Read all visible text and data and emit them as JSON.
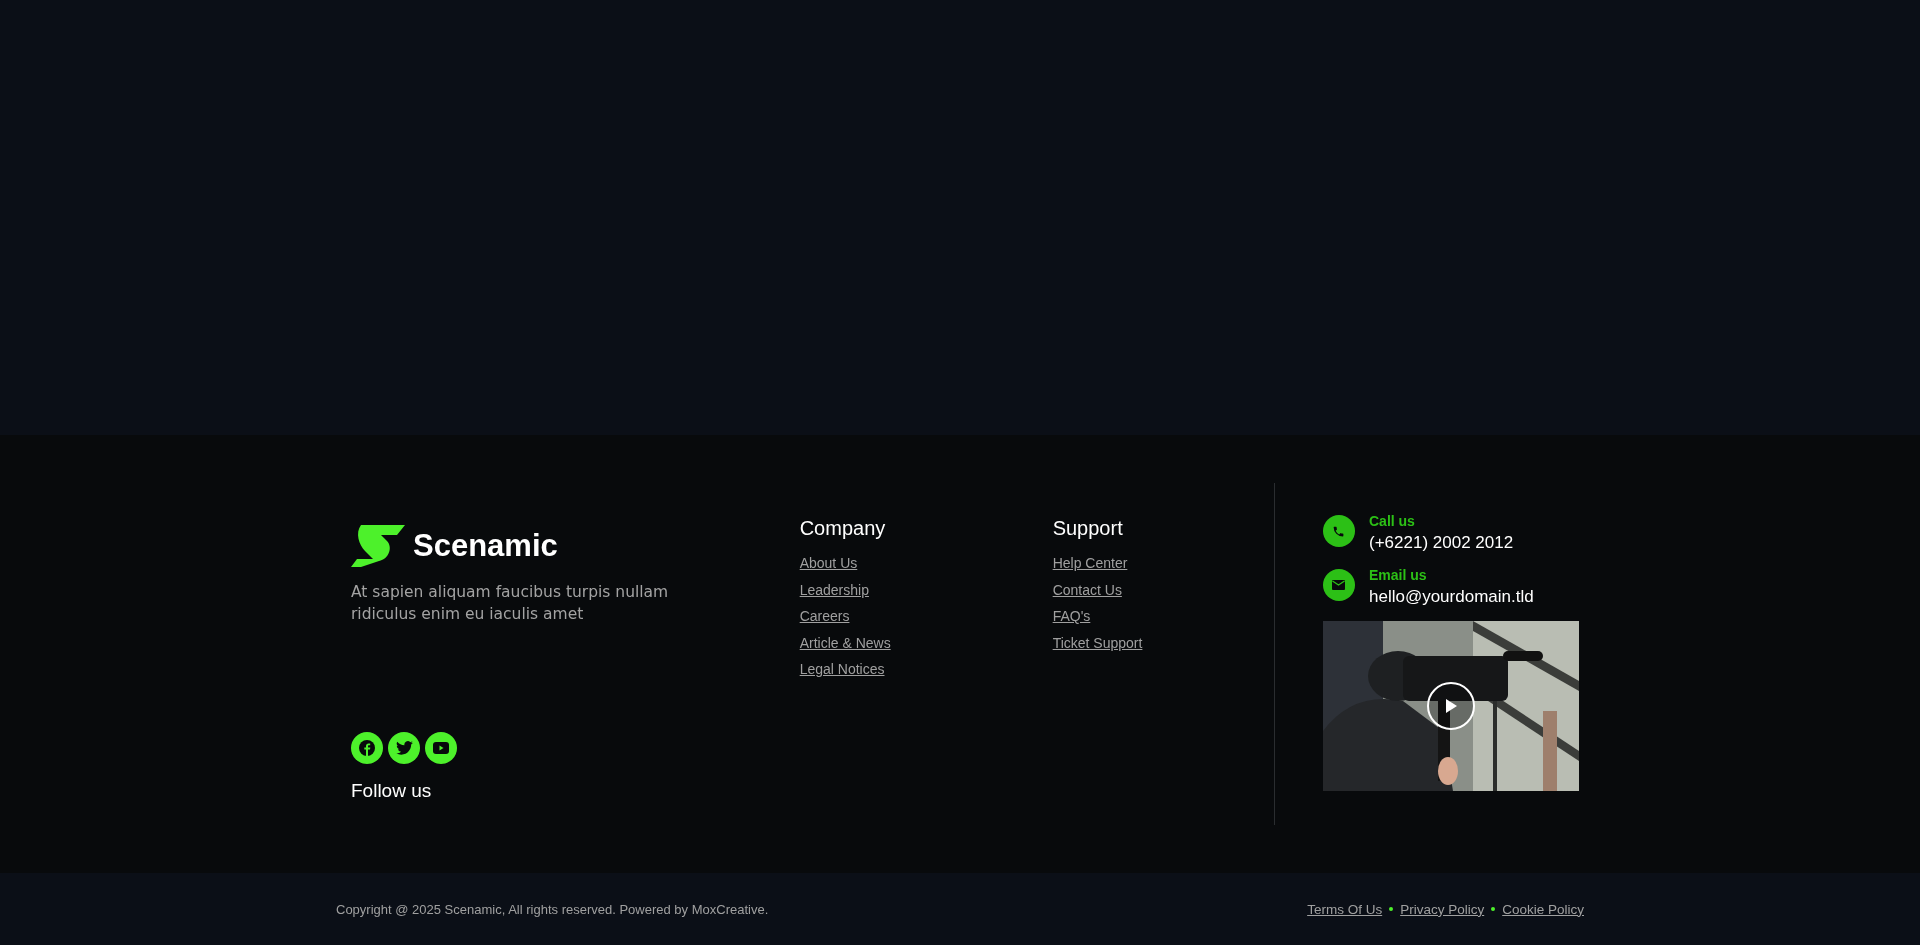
{
  "brand": {
    "name": "Scenamic",
    "description": "At sapien aliquam faucibus turpis nullam ridiculus enim eu iaculis amet"
  },
  "social": {
    "icons": [
      {
        "kind": "facebook"
      },
      {
        "kind": "twitter"
      },
      {
        "kind": "youtube"
      }
    ],
    "label": "Follow us"
  },
  "columns": [
    {
      "title": "Company",
      "links": [
        "About Us",
        "Leadership",
        "Careers",
        "Article & News",
        "Legal Notices"
      ]
    },
    {
      "title": "Support",
      "links": [
        "Help Center",
        "Contact Us",
        "FAQ's",
        "Ticket Support"
      ]
    }
  ],
  "contacts": [
    {
      "kind": "phone",
      "label": "Call us",
      "value": "(+6221) 2002 2012"
    },
    {
      "kind": "email",
      "label": "Email us",
      "value": "hello@yourdomain.tld"
    }
  ],
  "bottom_bar": {
    "copyright": "Copyright @ 2025 Scenamic, All rights reserved. Powered by MoxCreative.",
    "links": [
      "Terms Of Us",
      "Privacy Policy",
      "Cookie Policy"
    ]
  }
}
